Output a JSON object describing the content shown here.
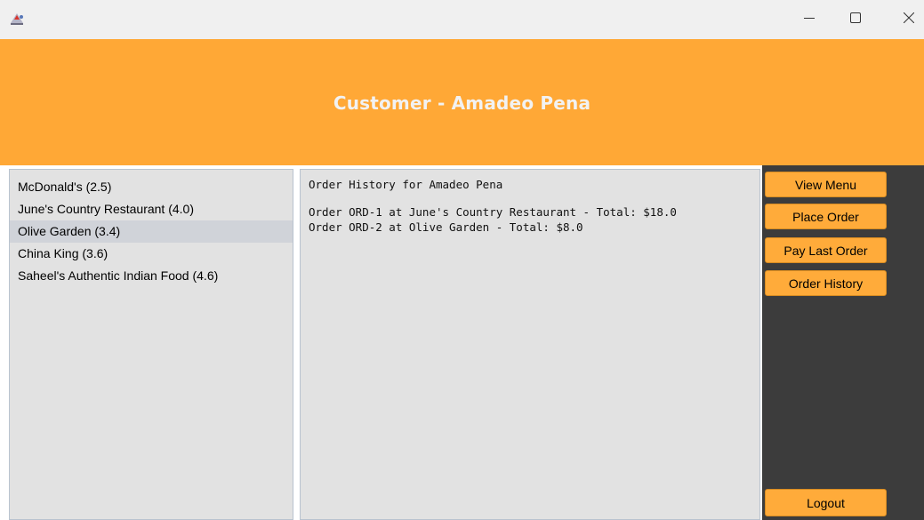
{
  "window": {
    "icon": "java-app-icon",
    "controls": {
      "minimize": "minimize-icon",
      "maximize": "maximize-icon",
      "close": "close-icon"
    }
  },
  "header": {
    "title": "Customer - Amadeo Pena",
    "background": "#ffa836"
  },
  "restaurants": {
    "items": [
      {
        "label": "McDonald's (2.5)",
        "selected": false
      },
      {
        "label": "June's Country Restaurant (4.0)",
        "selected": false
      },
      {
        "label": "Olive Garden (3.4)",
        "selected": true
      },
      {
        "label": "China King (3.6)",
        "selected": false
      },
      {
        "label": "Saheel's Authentic Indian Food (4.6)",
        "selected": false
      }
    ]
  },
  "history": {
    "heading": "Order History for Amadeo Pena",
    "orders": [
      "Order ORD-1 at June's Country Restaurant - Total: $18.0",
      "Order ORD-2 at Olive Garden - Total: $8.0"
    ]
  },
  "actions": {
    "view_menu": "View Menu",
    "place_order": "Place Order",
    "pay_last_order": "Pay Last Order",
    "order_history": "Order History",
    "logout": "Logout",
    "button_color": "#ffab3a",
    "panel_color": "#3c3c3c"
  }
}
